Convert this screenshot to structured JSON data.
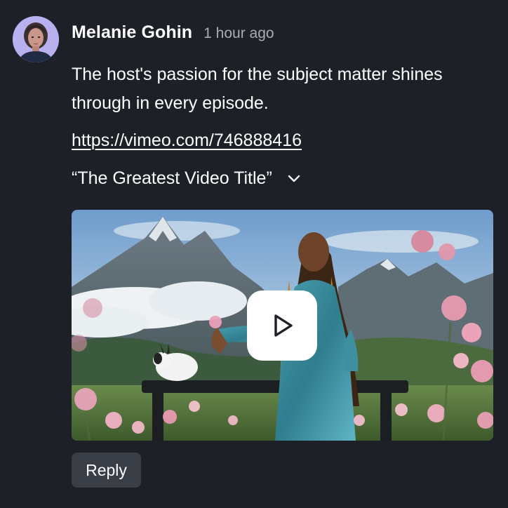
{
  "comment": {
    "author": "Melanie Gohin",
    "timestamp": "1 hour ago",
    "text": "The host's passion for the subject matter shines through in every episode.",
    "link": "https://vimeo.com/746888416",
    "video_title": "“The Greatest Video Title”",
    "reply_label": "Reply"
  },
  "icons": {
    "avatar": "user-avatar",
    "expand": "chevron-down-icon",
    "play": "play-icon"
  },
  "colors": {
    "background": "#1d2127",
    "text": "#ffffff",
    "muted": "#a8acb3",
    "reply_button": "#3a3f47",
    "avatar_bg": "#b7b0f0"
  }
}
